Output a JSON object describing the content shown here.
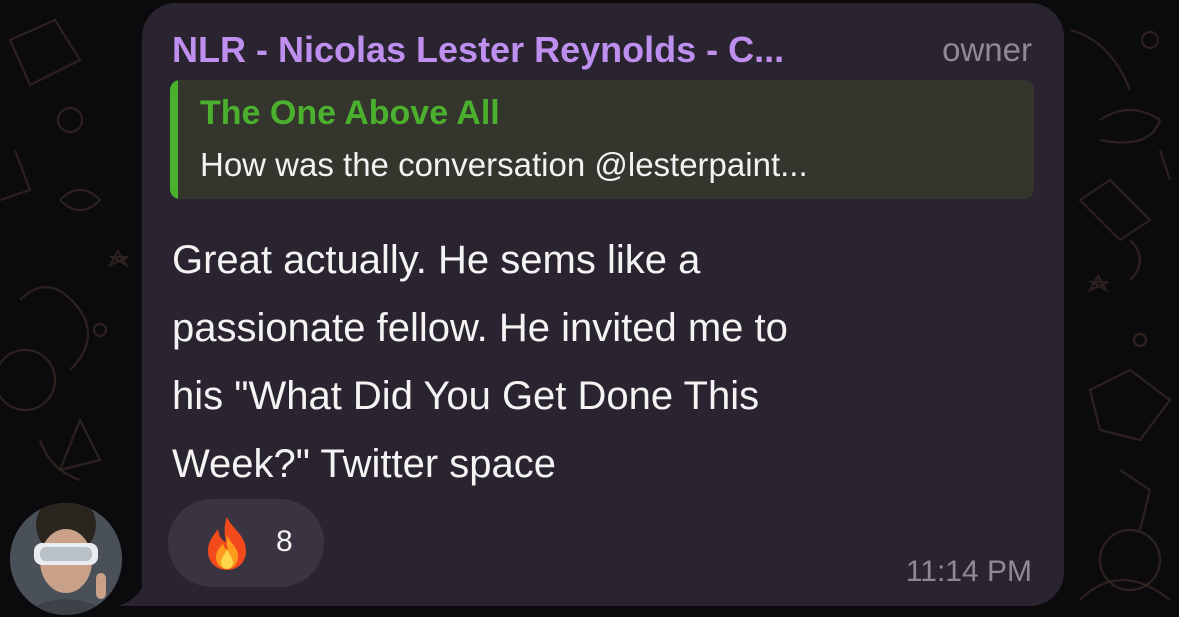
{
  "message": {
    "sender_name": "NLR - Nicolas Lester Reynolds - C...",
    "sender_role": "owner",
    "reply": {
      "author": "The One Above All",
      "snippet": "How was the conversation @lesterpaint..."
    },
    "text_lines": [
      "Great actually. He sems like a",
      "passionate fellow. He invited me to",
      "his \"What Did You Get Done This",
      "Week?\" Twitter space"
    ],
    "reaction": {
      "icon": "fire-emoji",
      "count": "8"
    },
    "timestamp": "11:14 PM"
  },
  "colors": {
    "bubble": "#2a2430",
    "sender": "#bf8ff0",
    "reply_accent": "#4cb02f",
    "reply_bg": "#34352c",
    "muted": "#8e8a92",
    "background": "#0b0b0d"
  }
}
